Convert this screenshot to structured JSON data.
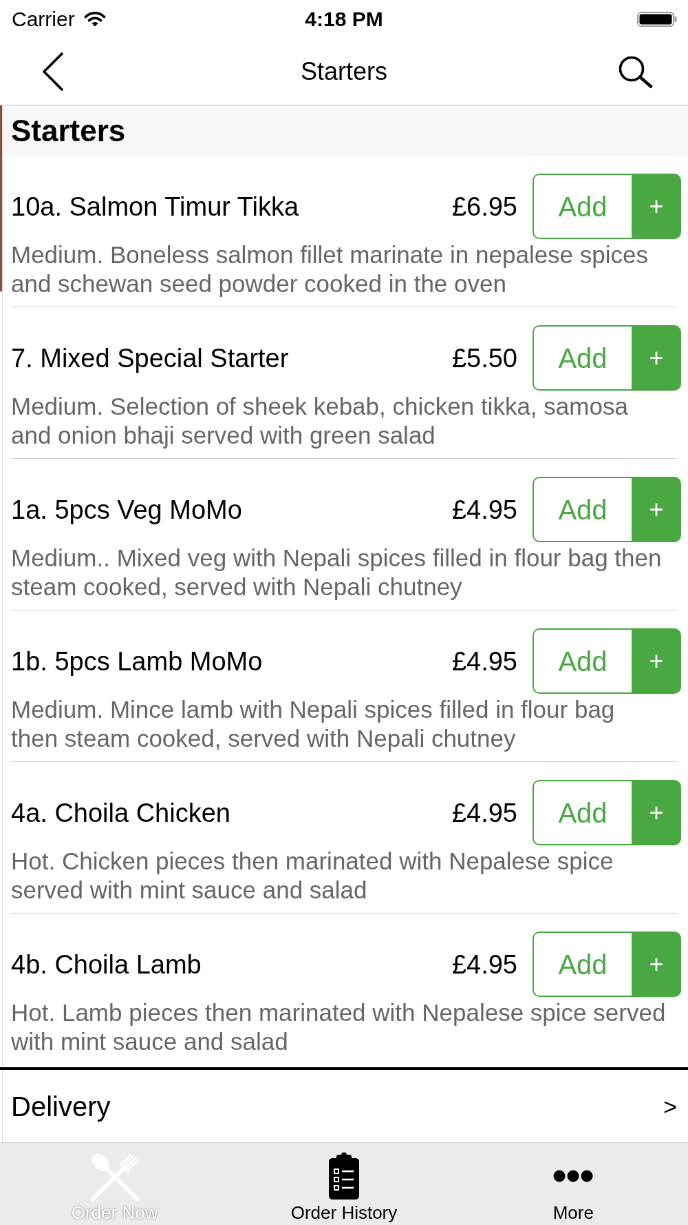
{
  "status_bar": {
    "carrier": "Carrier",
    "time": "4:18 PM"
  },
  "nav_bar": {
    "title": "Starters"
  },
  "section": {
    "title": "Starters"
  },
  "items": [
    {
      "name": "10a. Salmon Timur Tikka",
      "price": "£6.95",
      "description": "Medium. Boneless salmon fillet marinate in nepalese spices and schewan seed powder cooked in the oven",
      "add_label": "Add",
      "plus_label": "+"
    },
    {
      "name": "7. Mixed Special Starter",
      "price": "£5.50",
      "description": "Medium. Selection of sheek kebab, chicken tikka, samosa and onion bhaji served with green salad",
      "add_label": "Add",
      "plus_label": "+"
    },
    {
      "name": "1a. 5pcs Veg MoMo",
      "price": "£4.95",
      "description": "Medium.. Mixed veg with Nepali spices filled in flour bag then steam cooked, served with Nepali chutney",
      "add_label": "Add",
      "plus_label": "+"
    },
    {
      "name": "1b. 5pcs Lamb MoMo",
      "price": "£4.95",
      "description": "Medium. Mince lamb with Nepali spices filled in flour bag then steam cooked, served with Nepali chutney",
      "add_label": "Add",
      "plus_label": "+"
    },
    {
      "name": "4a. Choila Chicken",
      "price": "£4.95",
      "description": "Hot. Chicken pieces then marinated with Nepalese spice served with mint sauce and salad",
      "add_label": "Add",
      "plus_label": "+"
    },
    {
      "name": "4b. Choila Lamb",
      "price": "£4.95",
      "description": "Hot. Lamb pieces then marinated with Nepalese spice served with mint sauce and salad",
      "add_label": "Add",
      "plus_label": "+"
    }
  ],
  "delivery": {
    "label": "Delivery",
    "arrow": ">"
  },
  "tab_bar": [
    {
      "label": "Order Now",
      "selected": true
    },
    {
      "label": "Order History",
      "selected": false
    },
    {
      "label": "More",
      "selected": false
    }
  ]
}
